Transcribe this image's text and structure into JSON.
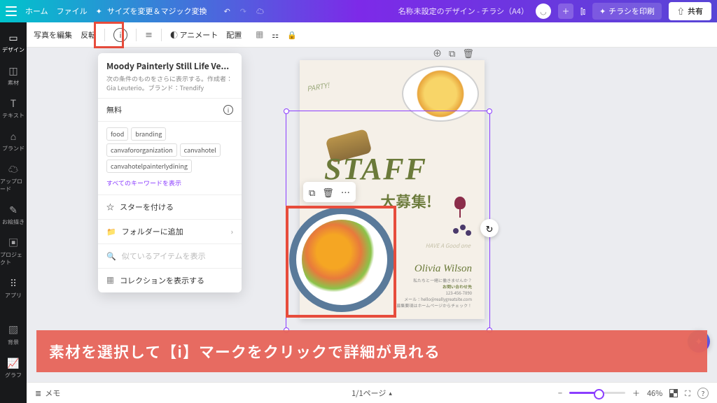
{
  "topbar": {
    "home": "ホーム",
    "file": "ファイル",
    "resize": "サイズを変更＆マジック変換",
    "doc_title": "名称未設定のデザイン - チラシ（A4）",
    "print": "チラシを印刷",
    "share": "共有"
  },
  "leftbar": [
    {
      "label": "デザイン"
    },
    {
      "label": "素材"
    },
    {
      "label": "テキスト"
    },
    {
      "label": "ブランド"
    },
    {
      "label": "アップロード"
    },
    {
      "label": "お絵描き"
    },
    {
      "label": "プロジェクト"
    },
    {
      "label": "アプリ"
    },
    {
      "label": "背景"
    },
    {
      "label": "グラフ"
    }
  ],
  "toolbar": {
    "edit_photo": "写真を編集",
    "flip": "反転",
    "animate": "アニメート",
    "position": "配置"
  },
  "info_panel": {
    "title": "Moody Painterly Still Life Ve...",
    "subtitle": "次の条件のものをさらに表示する。作成者：Gia Leuterio。ブランド：Trendify",
    "price": "無料",
    "tags": [
      "food",
      "branding",
      "canvafororganization",
      "canvahotel",
      "canvahotelpainterlydining"
    ],
    "all_keywords": "すべてのキーワードを表示",
    "star": "スターを付ける",
    "folder": "フォルダーに追加",
    "similar": "似ているアイテムを表示",
    "collection": "コレクションを表示する"
  },
  "canvas": {
    "staff": "STAFF",
    "recruit": "大募集!",
    "party": "PARTY!",
    "good": "HAVE A Good one",
    "signature": "Olivia Wilson",
    "fine1": "私たちと一緒に働きませんか？",
    "fine2": "お問い合わせ先",
    "fine3": "123-456-7890",
    "fine4": "メール：hello@reallygreatsite.com",
    "fine5": "募集要項はホームページからチェック！"
  },
  "caption": "素材を選択して【i】マークをクリックで詳細が見れる",
  "bottombar": {
    "memo": "メモ",
    "page": "1/1ページ",
    "zoom": "46%"
  }
}
